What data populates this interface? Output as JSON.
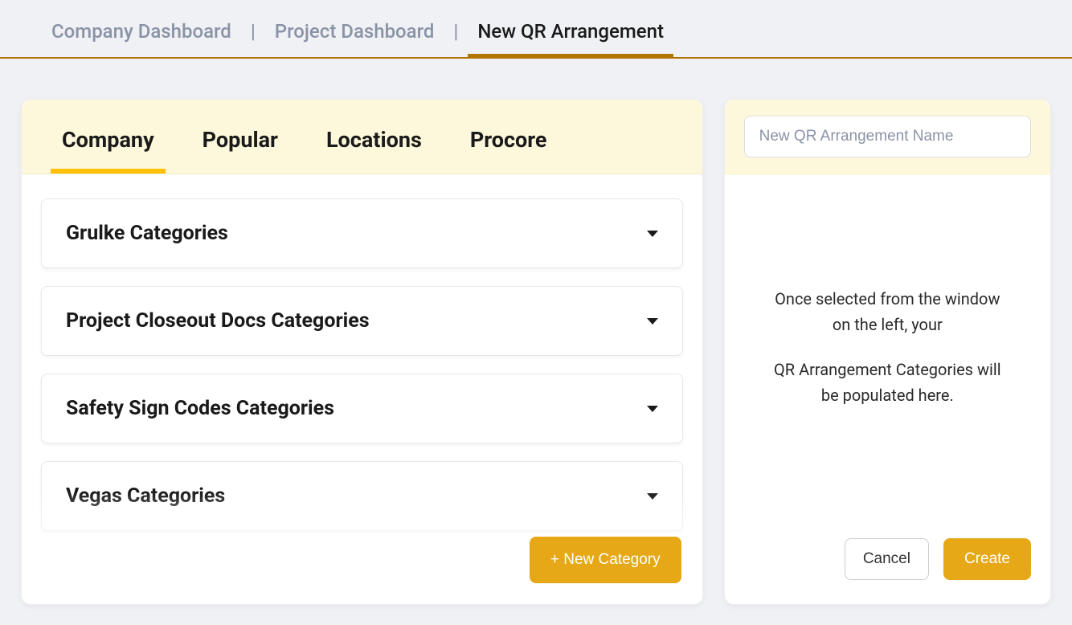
{
  "breadcrumb": {
    "items": [
      {
        "label": "Company Dashboard",
        "active": false
      },
      {
        "label": "Project Dashboard",
        "active": false
      },
      {
        "label": "New QR Arrangement",
        "active": true
      }
    ]
  },
  "tabs": [
    {
      "label": "Company",
      "active": true
    },
    {
      "label": "Popular",
      "active": false
    },
    {
      "label": "Locations",
      "active": false
    },
    {
      "label": "Procore",
      "active": false
    }
  ],
  "categories": [
    {
      "title": "Grulke Categories"
    },
    {
      "title": "Project Closeout Docs Categories"
    },
    {
      "title": "Safety Sign Codes Categories"
    },
    {
      "title": "Vegas Categories"
    }
  ],
  "new_category_label": "+ New Category",
  "right": {
    "name_placeholder": "New QR Arrangement Name",
    "placeholder_line1": "Once selected from the window on the left, your",
    "placeholder_line2": "QR Arrangement Categories will be populated here.",
    "cancel_label": "Cancel",
    "create_label": "Create"
  }
}
